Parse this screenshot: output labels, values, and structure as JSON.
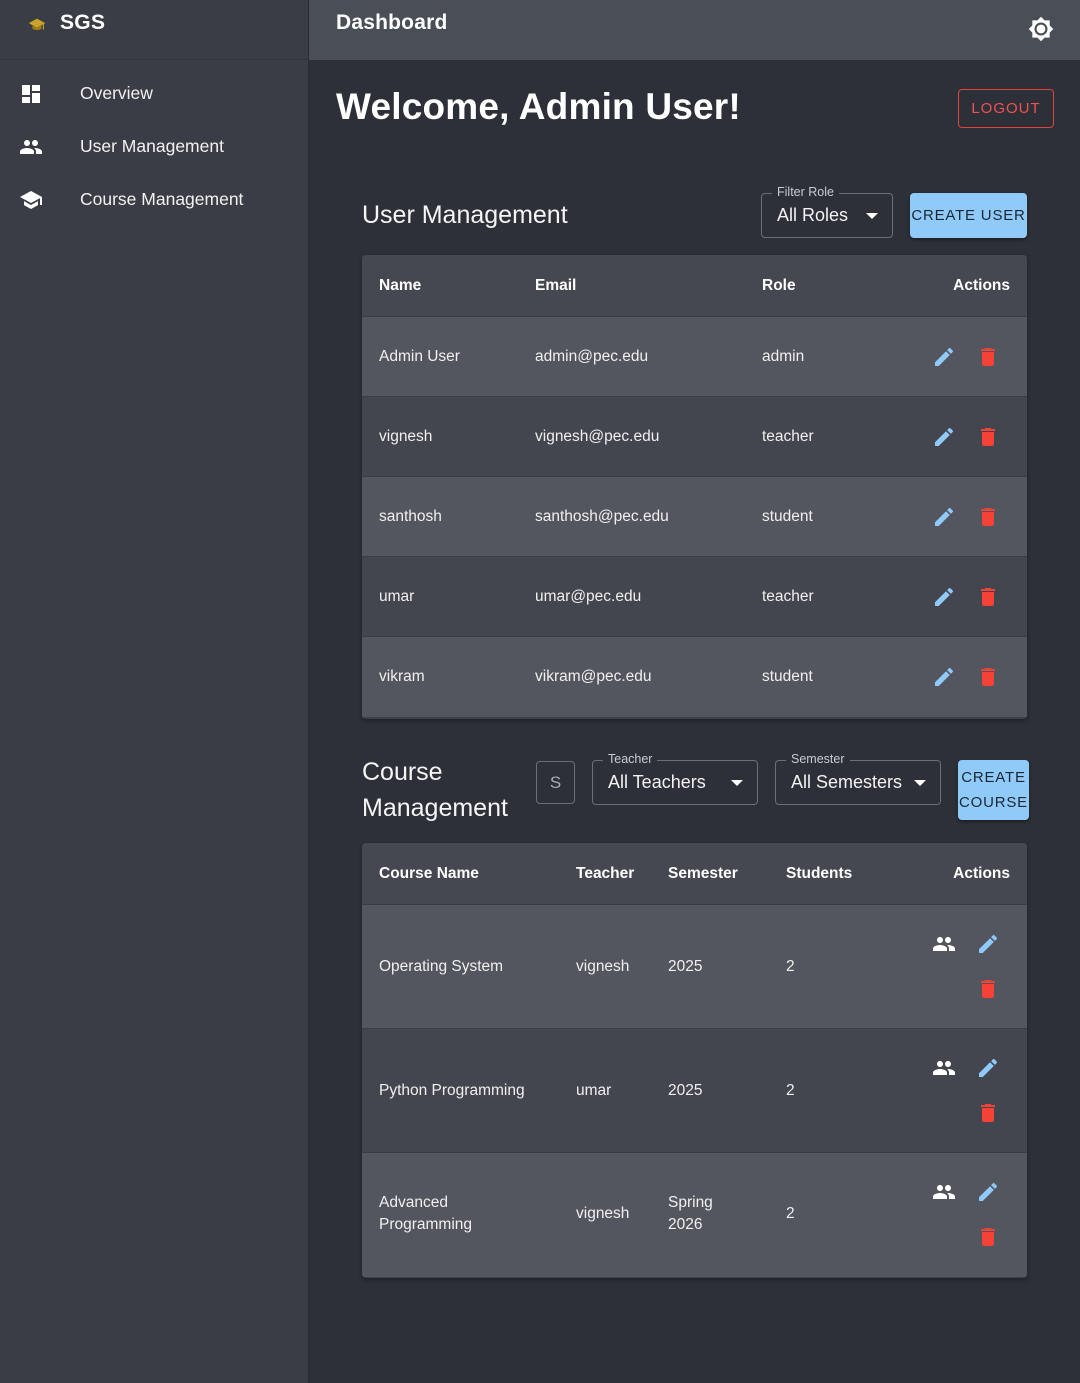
{
  "app": {
    "name": "SGS",
    "logo_icon": "graduation-cap-icon"
  },
  "sidebar": {
    "items": [
      {
        "label": "Overview",
        "icon": "dashboard-icon"
      },
      {
        "label": "User Management",
        "icon": "people-icon"
      },
      {
        "label": "Course Management",
        "icon": "school-icon"
      }
    ]
  },
  "topbar": {
    "title": "Dashboard",
    "theme_icon": "brightness-icon"
  },
  "main": {
    "welcome": "Welcome, Admin User!",
    "logout_label": "LOGOUT"
  },
  "users": {
    "title": "User Management",
    "filter": {
      "legend": "Filter Role",
      "value": "All Roles"
    },
    "create_label": "CREATE USER",
    "columns": [
      "Name",
      "Email",
      "Role",
      "Actions"
    ],
    "rows": [
      {
        "name": "Admin User",
        "email": "admin@pec.edu",
        "role": "admin"
      },
      {
        "name": "vignesh",
        "email": "vignesh@pec.edu",
        "role": "teacher"
      },
      {
        "name": "santhosh",
        "email": "santhosh@pec.edu",
        "role": "student"
      },
      {
        "name": "umar",
        "email": "umar@pec.edu",
        "role": "teacher"
      },
      {
        "name": "vikram",
        "email": "vikram@pec.edu",
        "role": "student"
      }
    ]
  },
  "courses": {
    "title_line1": "Course",
    "title_line2": "Management",
    "search_placeholder": "S",
    "teacher_filter": {
      "legend": "Teacher",
      "value": "All Teachers"
    },
    "semester_filter": {
      "legend": "Semester",
      "value": "All Semesters"
    },
    "create_line1": "CREATE",
    "create_line2": "COURSE",
    "columns": [
      "Course Name",
      "Teacher",
      "Semester",
      "Students",
      "Actions"
    ],
    "rows": [
      {
        "name_line1": "Operating System",
        "name_line2": "",
        "teacher": "vignesh",
        "semester_line1": "2025",
        "semester_line2": "",
        "students": "2"
      },
      {
        "name_line1": "Python Programming",
        "name_line2": "",
        "teacher": "umar",
        "semester_line1": "2025",
        "semester_line2": "",
        "students": "2"
      },
      {
        "name_line1": "Advanced",
        "name_line2": "Programming",
        "teacher": "vignesh",
        "semester_line1": "Spring",
        "semester_line2": "2026",
        "students": "2"
      }
    ]
  },
  "colors": {
    "accent": "#90caf9",
    "danger": "#f44336",
    "logout": "#ef5350",
    "edit_icon": "#90caf9"
  }
}
